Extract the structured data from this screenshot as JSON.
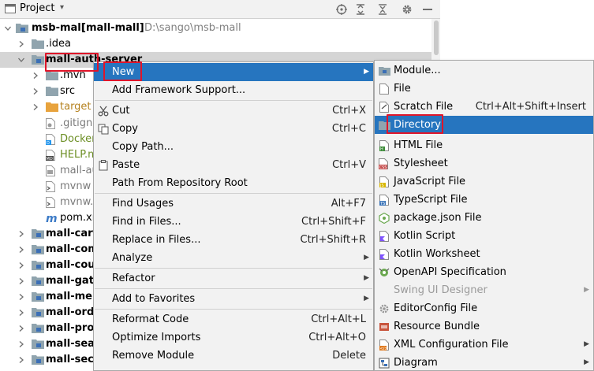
{
  "panel": {
    "title": "Project",
    "dropdown_arrow": "▾"
  },
  "tree": [
    {
      "label": "msb-mall",
      "suffix": "[mall-mall]",
      "path": "D:\\sango\\msb-mall",
      "arrow": "down",
      "icon": "module-folder"
    },
    {
      "label": ".idea",
      "arrow": "right",
      "icon": "folder"
    },
    {
      "label": "mall-auth-server",
      "arrow": "down",
      "icon": "module-folder",
      "selected": true
    },
    {
      "label": ".mvn",
      "arrow": "right",
      "icon": "folder"
    },
    {
      "label": "src",
      "arrow": "right",
      "icon": "folder"
    },
    {
      "label": "target",
      "arrow": "right",
      "icon": "orange-folder"
    },
    {
      "label": ".gitigno",
      "icon": "gitignore-file"
    },
    {
      "label": "Docker",
      "icon": "docker-file"
    },
    {
      "label": "HELP.m",
      "icon": "md-file"
    },
    {
      "label": "mall-au",
      "icon": "iml-file"
    },
    {
      "label": "mvnw",
      "icon": "mvnw-file"
    },
    {
      "label": "mvnw.",
      "icon": "mvnw-file"
    },
    {
      "label": "pom.xn",
      "icon": "maven-file"
    },
    {
      "label": "mall-cart",
      "arrow": "right",
      "icon": "module-folder"
    },
    {
      "label": "mall-com",
      "arrow": "right",
      "icon": "module-folder"
    },
    {
      "label": "mall-cou",
      "arrow": "right",
      "icon": "module-folder"
    },
    {
      "label": "mall-gate",
      "arrow": "right",
      "icon": "module-folder"
    },
    {
      "label": "mall-mer",
      "arrow": "right",
      "icon": "module-folder"
    },
    {
      "label": "mall-ord",
      "arrow": "right",
      "icon": "module-folder"
    },
    {
      "label": "mall-pro",
      "arrow": "right",
      "icon": "module-folder"
    },
    {
      "label": "mall-sear",
      "arrow": "right",
      "icon": "module-folder"
    },
    {
      "label": "mall-secl",
      "arrow": "right",
      "icon": "module-folder"
    }
  ],
  "context_menu": {
    "new": "New",
    "add_framework": "Add Framework Support...",
    "cut": "Cut",
    "cut_sc": "Ctrl+X",
    "copy": "Copy",
    "copy_sc": "Ctrl+C",
    "copy_path": "Copy Path...",
    "paste": "Paste",
    "paste_sc": "Ctrl+V",
    "path_from_repo": "Path From Repository Root",
    "find_usages": "Find Usages",
    "find_usages_sc": "Alt+F7",
    "find_in_files": "Find in Files...",
    "find_in_files_sc": "Ctrl+Shift+F",
    "replace_in_files": "Replace in Files...",
    "replace_in_files_sc": "Ctrl+Shift+R",
    "analyze": "Analyze",
    "refactor": "Refactor",
    "add_to_favorites": "Add to Favorites",
    "reformat_code": "Reformat Code",
    "reformat_code_sc": "Ctrl+Alt+L",
    "optimize_imports": "Optimize Imports",
    "optimize_imports_sc": "Ctrl+Alt+O",
    "remove_module": "Remove Module",
    "remove_module_sc": "Delete"
  },
  "submenu": {
    "module": "Module...",
    "file": "File",
    "scratch_file": "Scratch File",
    "scratch_file_sc": "Ctrl+Alt+Shift+Insert",
    "directory": "Directory",
    "html_file": "HTML File",
    "stylesheet": "Stylesheet",
    "javascript_file": "JavaScript File",
    "typescript_file": "TypeScript File",
    "package_json": "package.json File",
    "kotlin_script": "Kotlin Script",
    "kotlin_worksheet": "Kotlin Worksheet",
    "openapi": "OpenAPI Specification",
    "swing_ui": "Swing UI Designer",
    "editorconfig": "EditorConfig File",
    "resource_bundle": "Resource Bundle",
    "xml_config": "XML Configuration File",
    "diagram": "Diagram"
  },
  "colors": {
    "accent": "#2675bf",
    "annotation": "#e0152a",
    "folder": "#90a4ae",
    "target_folder": "#e8a33d",
    "selection": "#d5d5d5"
  }
}
